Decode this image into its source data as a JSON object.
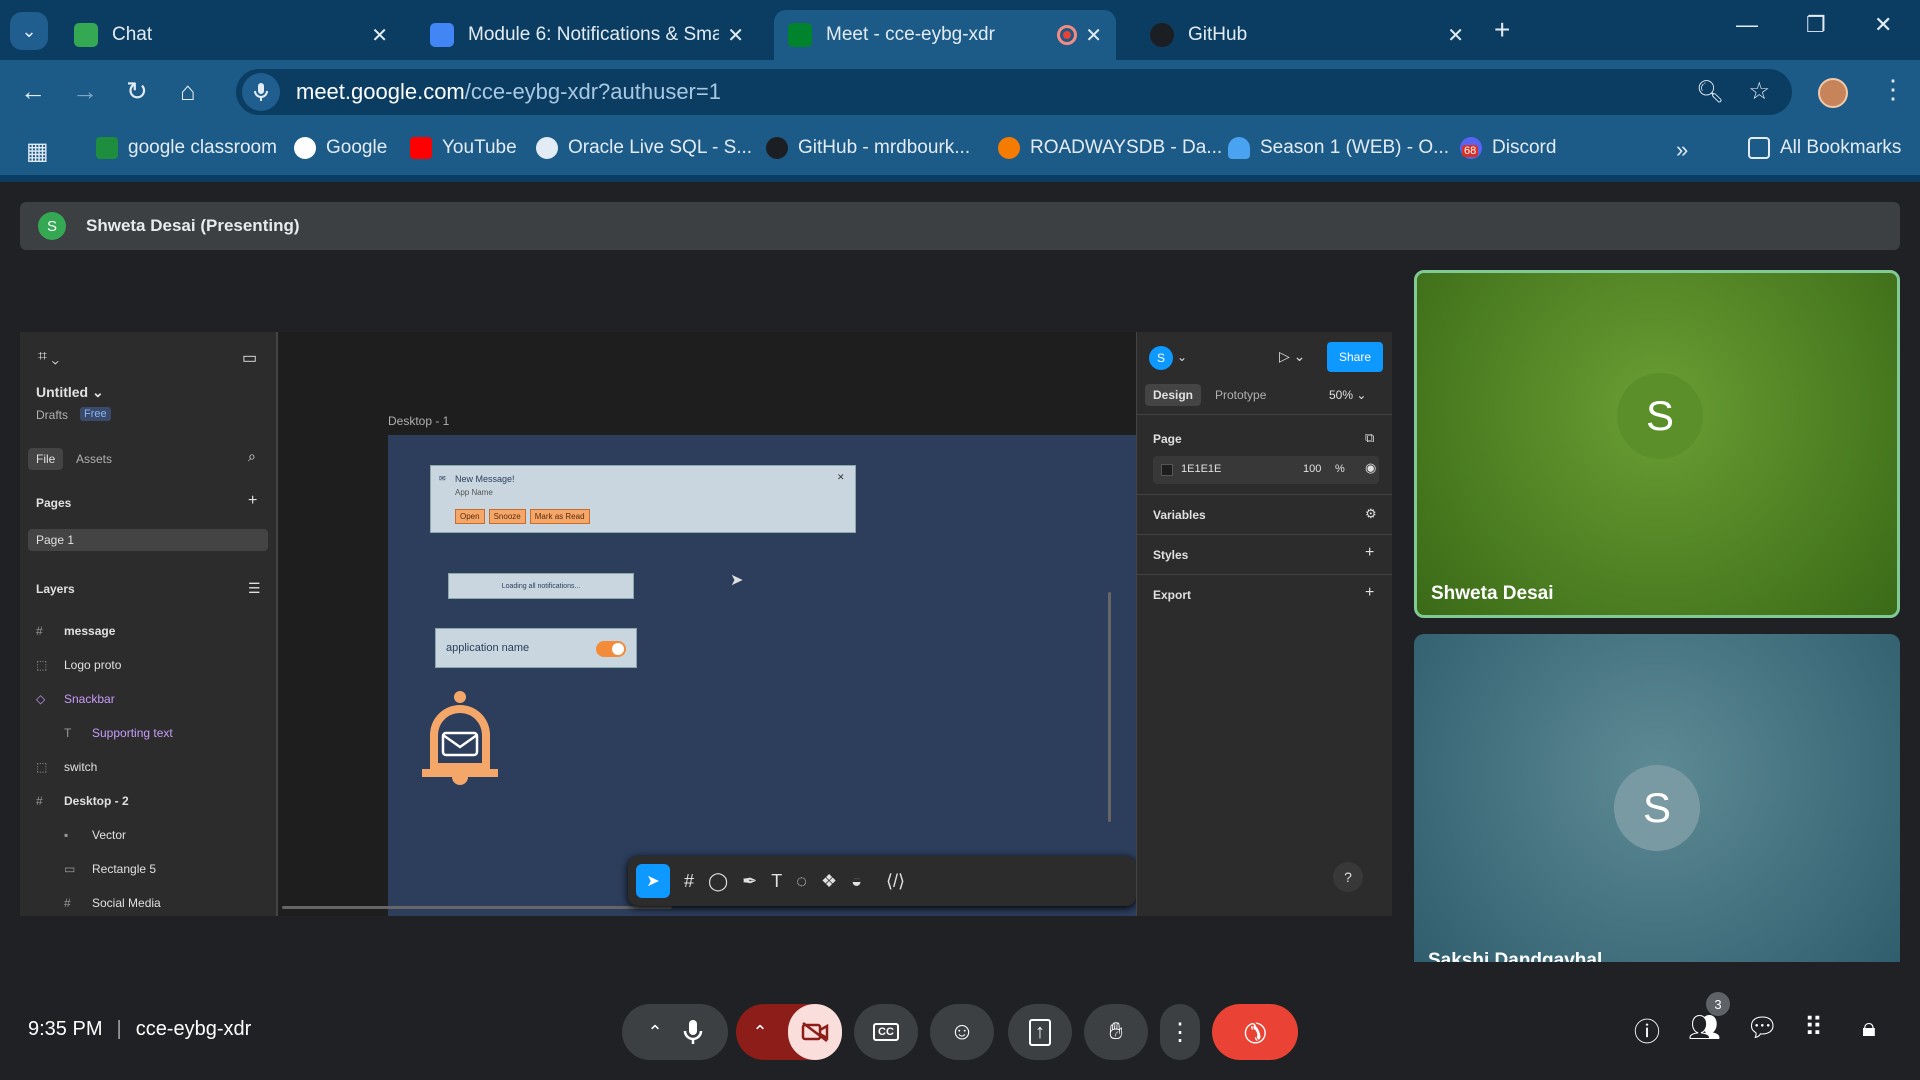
{
  "tabs": [
    {
      "label": "Chat"
    },
    {
      "label": "Module 6: Notifications & Smar"
    },
    {
      "label": "Meet - cce-eybg-xdr"
    },
    {
      "label": "GitHub"
    }
  ],
  "url": {
    "host": "meet.google.com",
    "path": "/cce-eybg-xdr?authuser=1"
  },
  "bookmarks": [
    "google classroom",
    "Google",
    "YouTube",
    "Oracle Live SQL - S...",
    "GitHub - mrdbourk...",
    "ROADWAYSDB - Da...",
    "Season 1 (WEB) - O...",
    "Discord"
  ],
  "bookmarks_badge": "68",
  "all_bookmarks": "All Bookmarks",
  "presenter": {
    "initial": "S",
    "label": "Shweta Desai (Presenting)"
  },
  "figma": {
    "file_name": "Untitled",
    "drafts": "Drafts",
    "plan": "Free",
    "tab_file": "File",
    "tab_assets": "Assets",
    "pages_label": "Pages",
    "page1": "Page 1",
    "layers_label": "Layers",
    "layers": [
      "message",
      "Logo proto",
      "Snackbar",
      "Supporting text",
      "switch",
      "Desktop - 2",
      "Vector",
      "Rectangle 5",
      "Social Media"
    ],
    "frame_label": "Desktop - 1",
    "notif_title": "New Message!",
    "notif_sub": "App Name",
    "notif_btns": [
      "Open",
      "Snooze",
      "Mark as Read"
    ],
    "loading": "Loading all notifications...",
    "appname": "application name",
    "user_initial": "S",
    "share": "Share",
    "design": "Design",
    "prototype": "Prototype",
    "zoom": "50%",
    "page_label": "Page",
    "bg_color": "1E1E1E",
    "opacity": "100",
    "percent": "%",
    "variables": "Variables",
    "styles": "Styles",
    "export": "Export",
    "help": "?"
  },
  "participants": [
    {
      "initial": "S",
      "name": "Shweta Desai",
      "color": "#5a8f29"
    },
    {
      "initial": "S",
      "name": "Sakshi Dandgavhal",
      "color": "#5d8a94"
    }
  ],
  "meeting": {
    "time": "9:35 PM",
    "code": "cce-eybg-xdr",
    "people_count": "3"
  }
}
